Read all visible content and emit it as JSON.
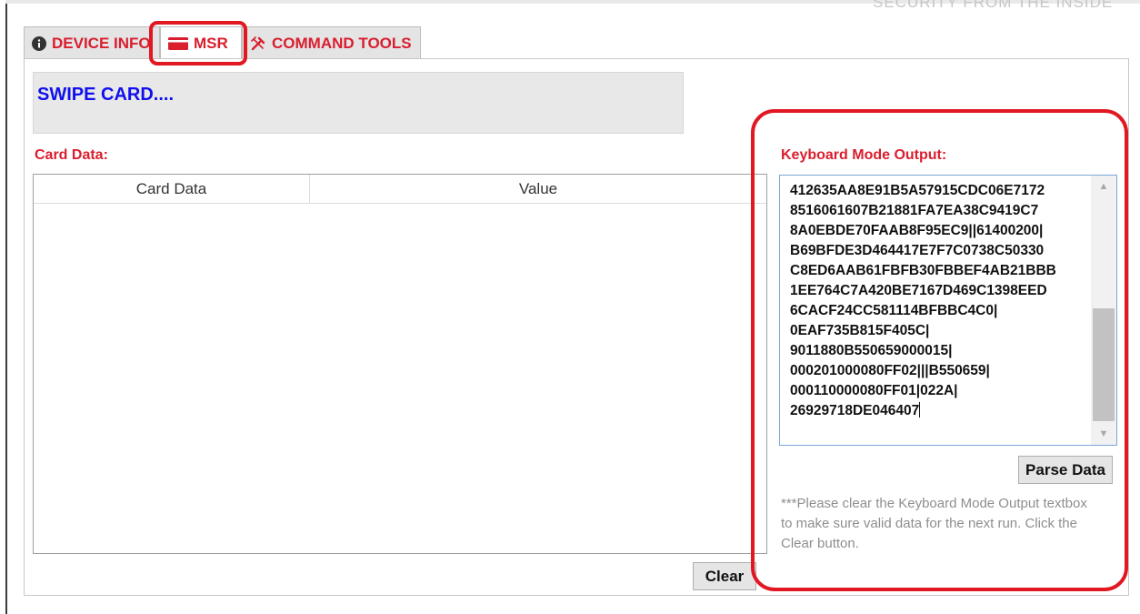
{
  "header": {
    "tagline": "SECURITY FROM THE INSIDE"
  },
  "tabs": [
    {
      "label": "DEVICE INFO",
      "icon": "info-circle-icon",
      "active": false
    },
    {
      "label": "MSR",
      "icon": "card-icon",
      "active": true
    },
    {
      "label": "COMMAND TOOLS",
      "icon": "tools-icon",
      "active": false
    }
  ],
  "status": {
    "message": "SWIPE CARD...."
  },
  "card_data": {
    "label": "Card Data:",
    "columns": [
      "Card Data",
      "Value"
    ],
    "rows": [],
    "clear_label": "Clear"
  },
  "keyboard_output": {
    "label": "Keyboard Mode Output:",
    "lines": [
      "412635AA8E91B5A57915CDC06E7172",
      "8516061607B21881FA7EA38C9419C7",
      "8A0EBDE70FAAB8F95EC9||61400200|",
      "B69BFDE3D464417E7F7C0738C50330",
      "C8ED6AAB61FBFB30FBBEF4AB21BBB",
      "1EE764C7A420BE7167D469C1398EED",
      "6CACF24CC581114BFBBC4C0|",
      "0EAF735B815F405C|",
      "9011880B550659000015|",
      "000201000080FF02|||B550659|",
      "000110000080FF01|022A|",
      "26929718DE046407"
    ],
    "parse_label": "Parse Data",
    "note": "***Please clear the Keyboard Mode Output textbox to make sure valid data for the next run. Click the Clear button."
  },
  "colors": {
    "accent_red": "#d91e2e",
    "status_blue": "#1010ee",
    "highlight_red": "#e11722"
  }
}
